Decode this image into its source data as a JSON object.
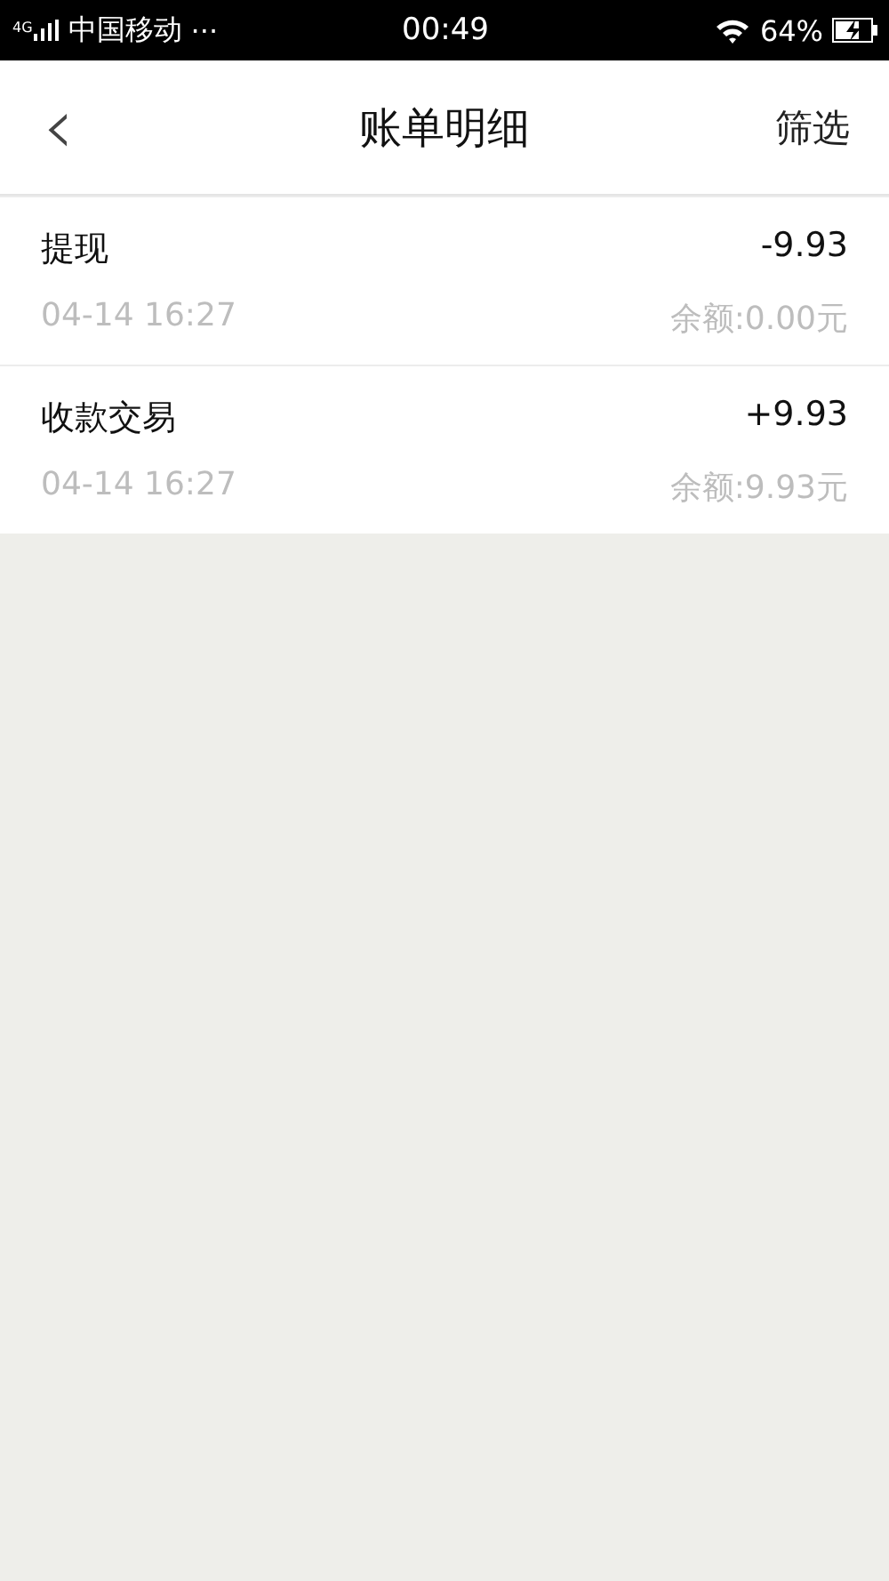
{
  "status_bar": {
    "network": "4G",
    "carrier": "中国移动",
    "more": "···",
    "time": "00:49",
    "battery": "64%"
  },
  "header": {
    "back": "‹",
    "title": "账单明细",
    "action": "筛选"
  },
  "transactions": [
    {
      "title": "提现",
      "amount": "-9.93",
      "time": "04-14 16:27",
      "balance": "余额:0.00元"
    },
    {
      "title": "收款交易",
      "amount": "+9.93",
      "time": "04-14 16:27",
      "balance": "余额:9.93元"
    }
  ]
}
